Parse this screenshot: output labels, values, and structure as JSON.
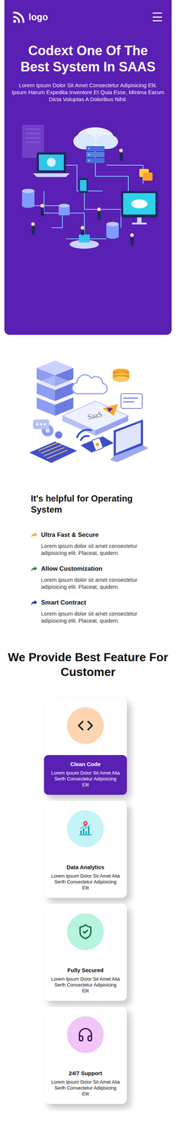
{
  "header": {
    "logo": "logo"
  },
  "hero": {
    "title": "Codext One Of The Best System In SAAS",
    "description": "Lorem Ipsum Dolor Sit Amet Consectetur Adipisicing Elit. Ipsum Harum Expedita Inventore Et Quia Esse, Minima Earum Dicta Voluptas A Doloribus Nihil."
  },
  "about": {
    "illustration_label": "SaaS",
    "heading": "It's helpful for Operating System",
    "items": [
      {
        "title": "Ultra Fast & Secure",
        "text": "Lorem ipsum dolor sit amet consectetur adipisicing elit. Placeat, quidem.",
        "color": "#f5a623"
      },
      {
        "title": "Allow Customization",
        "text": "Lorem ipsum dolor sit amet consectetur adipisicing elit. Placeat, quidem.",
        "color": "#1f8a3a"
      },
      {
        "title": "Smart Contract",
        "text": "Lorem ipsum dolor sit amet consectetur adipisicing elit. Placeat, quidem.",
        "color": "#1c2fa8"
      }
    ]
  },
  "features": {
    "heading": "We Provide Best Feature For Customer",
    "cards": [
      {
        "title": "Clean Code",
        "text": "Lorem Ipsum Dolor Sit Amet Alia Serlh Consectetur Adipisicing Elit",
        "selected": true,
        "color": "#fdd5b1"
      },
      {
        "title": "Data Analytics",
        "text": "Lorem Ipsum Dolor Sit Amet Alia Serlh Consectetur Adipisicing Elit",
        "selected": false,
        "color": "#c4f3f8"
      },
      {
        "title": "Fully Secured",
        "text": "Lorem Ipsum Dolor Sit Amet Alia Serlh Consectetur Adipisicing Elit",
        "selected": false,
        "color": "#b6f4dc"
      },
      {
        "title": "24/7 Support",
        "text": "Lorem Ipsum Dolor Sit Amet Alia Serlh Consectetur Adipisicing Elit",
        "selected": false,
        "color": "#f1c6f6"
      }
    ]
  }
}
